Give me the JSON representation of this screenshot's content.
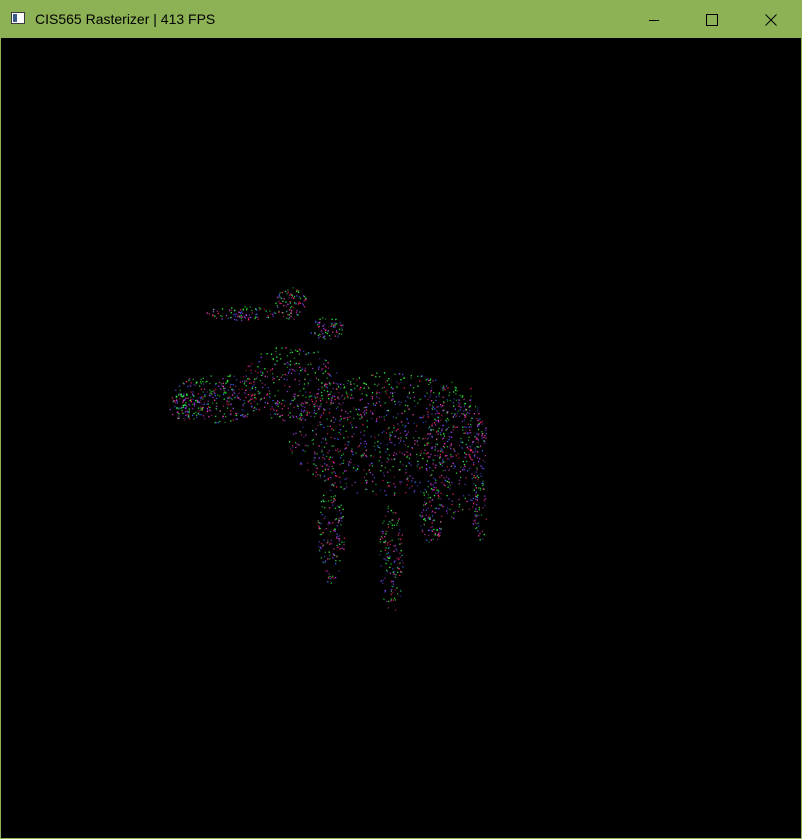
{
  "window": {
    "title": "CIS565 Rasterizer | 413 FPS",
    "titlebar_color": "#8db255",
    "background_color": "#000000",
    "controls": {
      "minimize_icon": "minimize-icon",
      "maximize_icon": "maximize-icon",
      "close_icon": "close-icon"
    }
  },
  "viewport": {
    "content": "point-cloud cow model",
    "point_colors": [
      "#ff2060",
      "#30ff40",
      "#4060ff",
      "#ff40c0",
      "#a040ff"
    ]
  }
}
